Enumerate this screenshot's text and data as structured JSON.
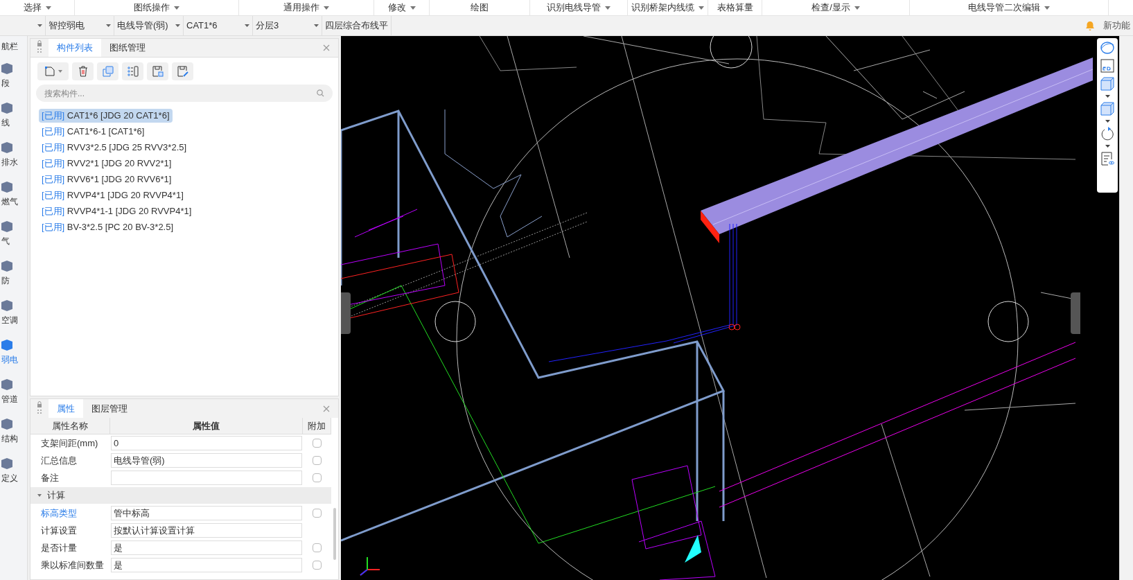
{
  "menu": [
    {
      "label": "选择",
      "caret": true
    },
    {
      "label": "图纸操作",
      "caret": true
    },
    {
      "label": "通用操作",
      "caret": true
    },
    {
      "label": "修改",
      "caret": true
    },
    {
      "label": "绘图",
      "caret": false
    },
    {
      "label": "识别电线导管",
      "caret": true
    },
    {
      "label": "识别桥架内线缆",
      "caret": true
    },
    {
      "label": "表格算量",
      "caret": false
    },
    {
      "label": "检查/显示",
      "caret": true
    },
    {
      "label": "电线导管二次编辑",
      "caret": true
    }
  ],
  "selectors": [
    {
      "value": "智控弱电"
    },
    {
      "value": "电线导管(弱)"
    },
    {
      "value": "CAT1*6"
    },
    {
      "value": "分层3"
    },
    {
      "value": "四层综合布线平"
    }
  ],
  "notice": "新功能",
  "nav": {
    "title": "航栏",
    "items": [
      {
        "label": "段",
        "selected": false
      },
      {
        "label": "线",
        "selected": false
      },
      {
        "label": "排水",
        "selected": false
      },
      {
        "label": "燃气",
        "selected": false
      },
      {
        "label": "气",
        "selected": false
      },
      {
        "label": "防",
        "selected": false
      },
      {
        "label": "空调",
        "selected": false
      },
      {
        "label": "弱电",
        "selected": true
      },
      {
        "label": "管道",
        "selected": false
      },
      {
        "label": "结构",
        "selected": false
      },
      {
        "label": "定义",
        "selected": false
      }
    ]
  },
  "component_panel": {
    "tabs": [
      {
        "label": "构件列表",
        "selected": true
      },
      {
        "label": "图纸管理",
        "selected": false
      }
    ],
    "search": {
      "placeholder": "搜索构件..."
    },
    "items": [
      {
        "status": "[已用]",
        "label": "CAT1*6 [JDG 20 CAT1*6]",
        "selected": true
      },
      {
        "status": "[已用]",
        "label": "CAT1*6-1 [CAT1*6]",
        "selected": false
      },
      {
        "status": "[已用]",
        "label": "RVV3*2.5 [JDG 25 RVV3*2.5]",
        "selected": false
      },
      {
        "status": "[已用]",
        "label": "RVV2*1 [JDG 20 RVV2*1]",
        "selected": false
      },
      {
        "status": "[已用]",
        "label": "RVV6*1 [JDG 20 RVV6*1]",
        "selected": false
      },
      {
        "status": "[已用]",
        "label": "RVVP4*1 [JDG 20 RVVP4*1]",
        "selected": false
      },
      {
        "status": "[已用]",
        "label": "RVVP4*1-1 [JDG 20 RVVP4*1]",
        "selected": false
      },
      {
        "status": "[已用]",
        "label": "BV-3*2.5 [PC 20 BV-3*2.5]",
        "selected": false
      }
    ]
  },
  "property_panel": {
    "tabs": [
      {
        "label": "属性",
        "selected": true
      },
      {
        "label": "图层管理",
        "selected": false
      }
    ],
    "columns": [
      "属性名称",
      "属性值",
      "附加"
    ],
    "rows": [
      {
        "kind": "row",
        "name": "支架间距(mm)",
        "value": "0",
        "highlighted": false,
        "extra": true,
        "checked": false
      },
      {
        "kind": "row",
        "name": "汇总信息",
        "value": "电线导管(弱)",
        "highlighted": false,
        "extra": true,
        "checked": false
      },
      {
        "kind": "row",
        "name": "备注",
        "highlighted": false,
        "extra": true,
        "checked": false
      },
      {
        "kind": "group",
        "name": "计算",
        "expanded": true
      },
      {
        "kind": "row",
        "name": "标高类型",
        "value": "管中标高",
        "highlighted": true,
        "extra": true,
        "checked": false
      },
      {
        "kind": "row",
        "name": "计算设置",
        "value": "按默认计算设置计算",
        "highlighted": false,
        "extra": false
      },
      {
        "kind": "row",
        "name": "是否计量",
        "value": "是",
        "highlighted": false,
        "extra": true,
        "checked": false
      },
      {
        "kind": "row",
        "name": "乘以标准间数量",
        "value": "是",
        "highlighted": false,
        "extra": true,
        "checked": false
      }
    ]
  }
}
